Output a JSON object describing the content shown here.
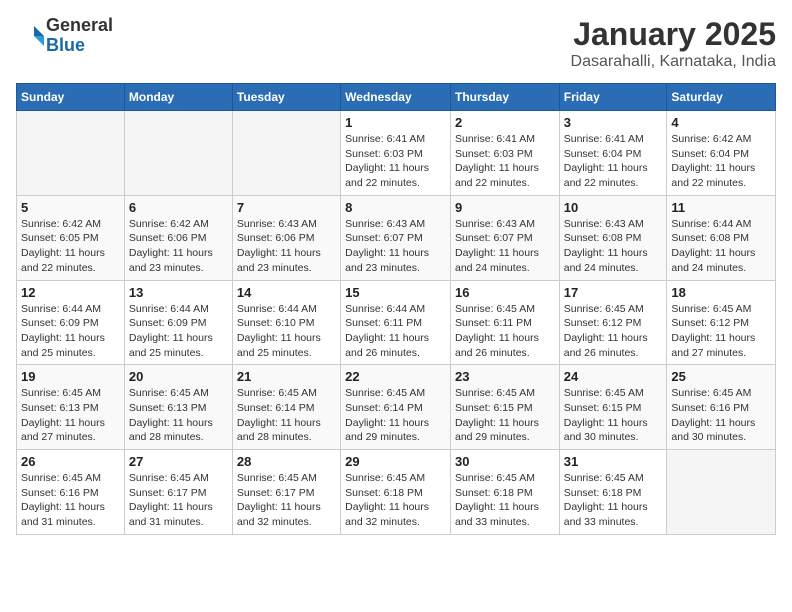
{
  "logo": {
    "general": "General",
    "blue": "Blue"
  },
  "header": {
    "month": "January 2025",
    "location": "Dasarahalli, Karnataka, India"
  },
  "weekdays": [
    "Sunday",
    "Monday",
    "Tuesday",
    "Wednesday",
    "Thursday",
    "Friday",
    "Saturday"
  ],
  "weeks": [
    [
      {
        "day": "",
        "info": ""
      },
      {
        "day": "",
        "info": ""
      },
      {
        "day": "",
        "info": ""
      },
      {
        "day": "1",
        "info": "Sunrise: 6:41 AM\nSunset: 6:03 PM\nDaylight: 11 hours\nand 22 minutes."
      },
      {
        "day": "2",
        "info": "Sunrise: 6:41 AM\nSunset: 6:03 PM\nDaylight: 11 hours\nand 22 minutes."
      },
      {
        "day": "3",
        "info": "Sunrise: 6:41 AM\nSunset: 6:04 PM\nDaylight: 11 hours\nand 22 minutes."
      },
      {
        "day": "4",
        "info": "Sunrise: 6:42 AM\nSunset: 6:04 PM\nDaylight: 11 hours\nand 22 minutes."
      }
    ],
    [
      {
        "day": "5",
        "info": "Sunrise: 6:42 AM\nSunset: 6:05 PM\nDaylight: 11 hours\nand 22 minutes."
      },
      {
        "day": "6",
        "info": "Sunrise: 6:42 AM\nSunset: 6:06 PM\nDaylight: 11 hours\nand 23 minutes."
      },
      {
        "day": "7",
        "info": "Sunrise: 6:43 AM\nSunset: 6:06 PM\nDaylight: 11 hours\nand 23 minutes."
      },
      {
        "day": "8",
        "info": "Sunrise: 6:43 AM\nSunset: 6:07 PM\nDaylight: 11 hours\nand 23 minutes."
      },
      {
        "day": "9",
        "info": "Sunrise: 6:43 AM\nSunset: 6:07 PM\nDaylight: 11 hours\nand 24 minutes."
      },
      {
        "day": "10",
        "info": "Sunrise: 6:43 AM\nSunset: 6:08 PM\nDaylight: 11 hours\nand 24 minutes."
      },
      {
        "day": "11",
        "info": "Sunrise: 6:44 AM\nSunset: 6:08 PM\nDaylight: 11 hours\nand 24 minutes."
      }
    ],
    [
      {
        "day": "12",
        "info": "Sunrise: 6:44 AM\nSunset: 6:09 PM\nDaylight: 11 hours\nand 25 minutes."
      },
      {
        "day": "13",
        "info": "Sunrise: 6:44 AM\nSunset: 6:09 PM\nDaylight: 11 hours\nand 25 minutes."
      },
      {
        "day": "14",
        "info": "Sunrise: 6:44 AM\nSunset: 6:10 PM\nDaylight: 11 hours\nand 25 minutes."
      },
      {
        "day": "15",
        "info": "Sunrise: 6:44 AM\nSunset: 6:11 PM\nDaylight: 11 hours\nand 26 minutes."
      },
      {
        "day": "16",
        "info": "Sunrise: 6:45 AM\nSunset: 6:11 PM\nDaylight: 11 hours\nand 26 minutes."
      },
      {
        "day": "17",
        "info": "Sunrise: 6:45 AM\nSunset: 6:12 PM\nDaylight: 11 hours\nand 26 minutes."
      },
      {
        "day": "18",
        "info": "Sunrise: 6:45 AM\nSunset: 6:12 PM\nDaylight: 11 hours\nand 27 minutes."
      }
    ],
    [
      {
        "day": "19",
        "info": "Sunrise: 6:45 AM\nSunset: 6:13 PM\nDaylight: 11 hours\nand 27 minutes."
      },
      {
        "day": "20",
        "info": "Sunrise: 6:45 AM\nSunset: 6:13 PM\nDaylight: 11 hours\nand 28 minutes."
      },
      {
        "day": "21",
        "info": "Sunrise: 6:45 AM\nSunset: 6:14 PM\nDaylight: 11 hours\nand 28 minutes."
      },
      {
        "day": "22",
        "info": "Sunrise: 6:45 AM\nSunset: 6:14 PM\nDaylight: 11 hours\nand 29 minutes."
      },
      {
        "day": "23",
        "info": "Sunrise: 6:45 AM\nSunset: 6:15 PM\nDaylight: 11 hours\nand 29 minutes."
      },
      {
        "day": "24",
        "info": "Sunrise: 6:45 AM\nSunset: 6:15 PM\nDaylight: 11 hours\nand 30 minutes."
      },
      {
        "day": "25",
        "info": "Sunrise: 6:45 AM\nSunset: 6:16 PM\nDaylight: 11 hours\nand 30 minutes."
      }
    ],
    [
      {
        "day": "26",
        "info": "Sunrise: 6:45 AM\nSunset: 6:16 PM\nDaylight: 11 hours\nand 31 minutes."
      },
      {
        "day": "27",
        "info": "Sunrise: 6:45 AM\nSunset: 6:17 PM\nDaylight: 11 hours\nand 31 minutes."
      },
      {
        "day": "28",
        "info": "Sunrise: 6:45 AM\nSunset: 6:17 PM\nDaylight: 11 hours\nand 32 minutes."
      },
      {
        "day": "29",
        "info": "Sunrise: 6:45 AM\nSunset: 6:18 PM\nDaylight: 11 hours\nand 32 minutes."
      },
      {
        "day": "30",
        "info": "Sunrise: 6:45 AM\nSunset: 6:18 PM\nDaylight: 11 hours\nand 33 minutes."
      },
      {
        "day": "31",
        "info": "Sunrise: 6:45 AM\nSunset: 6:18 PM\nDaylight: 11 hours\nand 33 minutes."
      },
      {
        "day": "",
        "info": ""
      }
    ]
  ]
}
